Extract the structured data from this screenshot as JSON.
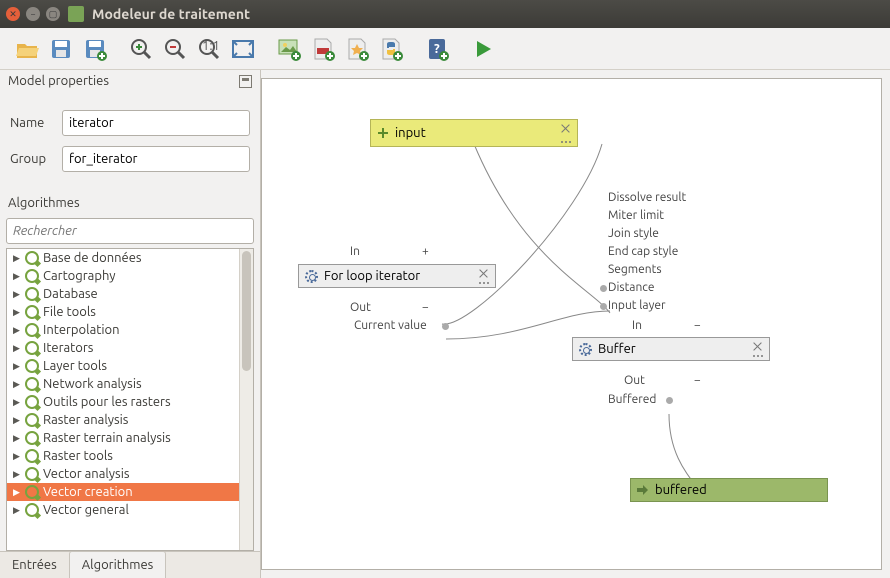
{
  "window": {
    "title": "Modeleur de traitement"
  },
  "panels": {
    "props_title": "Model properties",
    "algo_title": "Algorithmes",
    "name_label": "Name",
    "group_label": "Group"
  },
  "model": {
    "name": "iterator",
    "group": "for_iterator"
  },
  "search": {
    "placeholder": "Rechercher"
  },
  "tree": [
    "Base de données",
    "Cartography",
    "Database",
    "File tools",
    "Interpolation",
    "Iterators",
    "Layer tools",
    "Network analysis",
    "Outils pour les rasters",
    "Raster analysis",
    "Raster terrain analysis",
    "Raster tools",
    "Vector analysis",
    "Vector creation",
    "Vector general"
  ],
  "tree_selected": 13,
  "tabs": {
    "left": "Entrées",
    "right": "Algorithmes"
  },
  "nodes": {
    "input": {
      "label": "input"
    },
    "forloop": {
      "label": "For loop iterator",
      "in": "In",
      "in_plus": "+",
      "out": "Out",
      "out_minus": "−",
      "curval": "Current value"
    },
    "buffer": {
      "label": "Buffer",
      "params": [
        "Dissolve result",
        "Miter limit",
        "Join style",
        "End cap style",
        "Segments",
        "Distance",
        "Input layer"
      ],
      "in": "In",
      "in_minus": "−",
      "out": "Out",
      "out_minus": "−",
      "buffered_port": "Buffered"
    },
    "output": {
      "label": "buffered"
    }
  }
}
